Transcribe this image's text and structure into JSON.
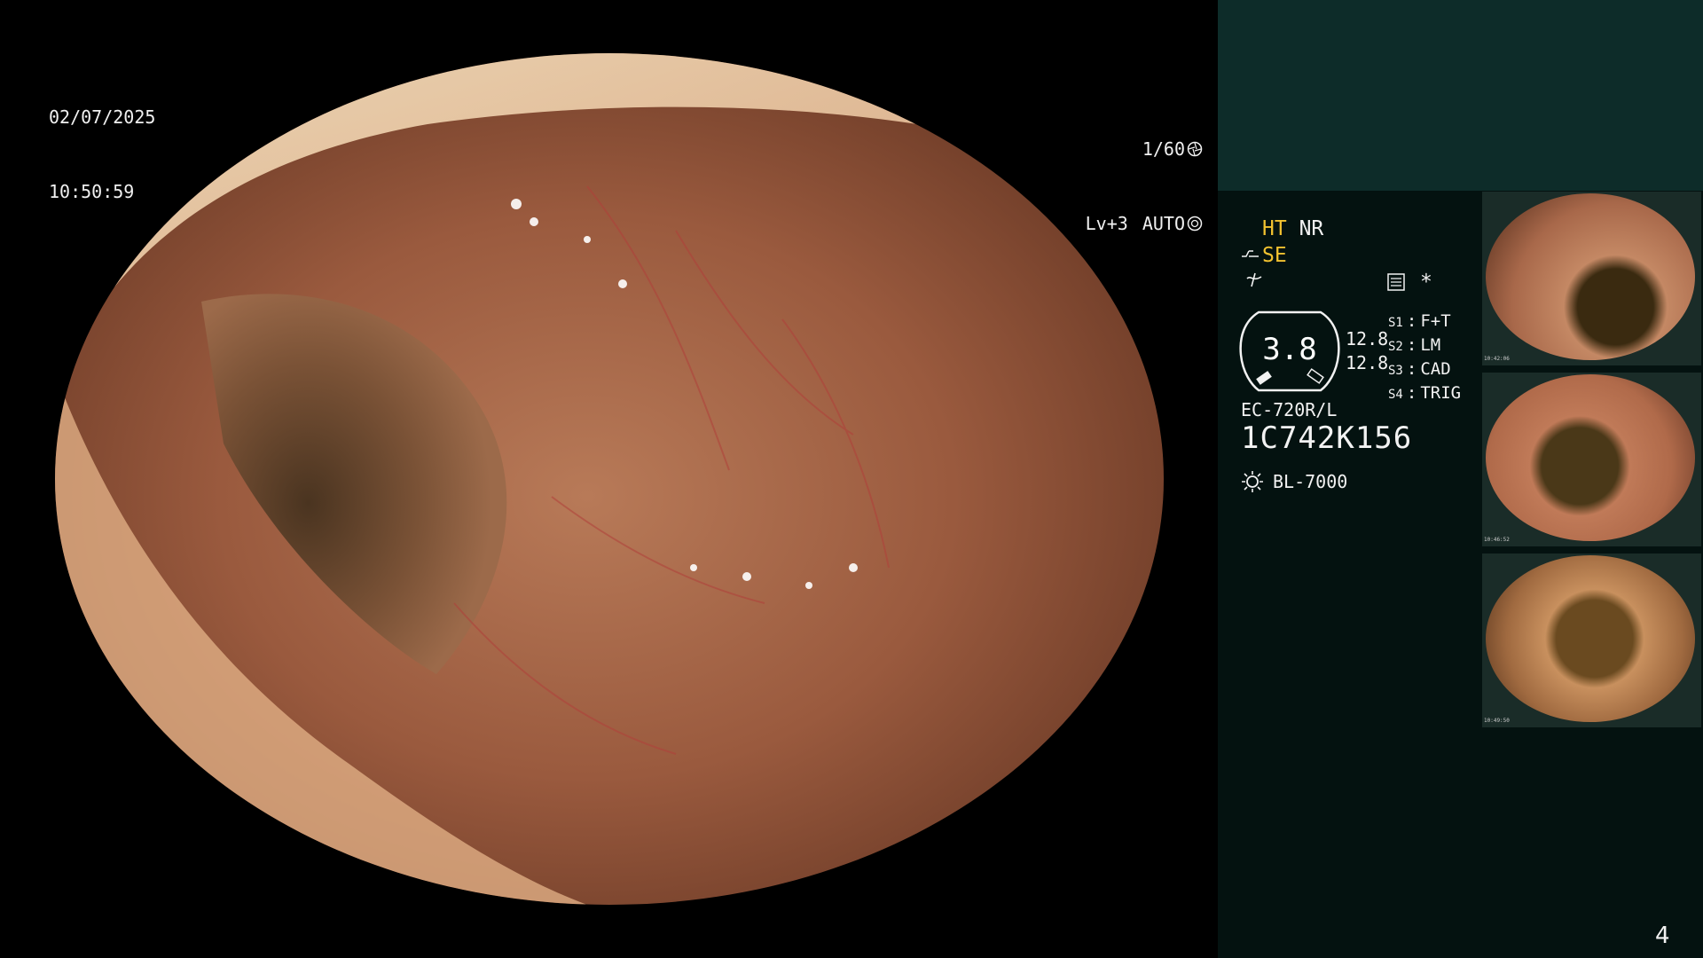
{
  "overlay": {
    "date": "02/07/2025",
    "time": "10:50:59",
    "shutter_speed": "1/60",
    "brightness_level": "Lv+3",
    "exposure_mode": "AUTO"
  },
  "info": {
    "ht": "HT",
    "nr": "NR",
    "se": "SE",
    "gauge_value": "3.8",
    "gauge_side_top": "12.8",
    "gauge_side_bottom": "12.8",
    "switches": [
      {
        "key": "S1",
        "value": "F+T"
      },
      {
        "key": "S2",
        "value": "LM"
      },
      {
        "key": "S3",
        "value": "CAD"
      },
      {
        "key": "S4",
        "value": "TRIG"
      }
    ],
    "scope_model": "EC-720R/L",
    "scope_serial": "1C742K156",
    "light_source": "BL-7000",
    "asterisk": "*"
  },
  "thumbnails": [
    {
      "caption": "10:42:06"
    },
    {
      "caption": "10:46:52"
    },
    {
      "caption": "10:49:50"
    }
  ],
  "page_number": "4",
  "colors": {
    "accent_yellow": "#f2c230",
    "panel_bg": "#041210",
    "panel_top_bg": "#0d2c29"
  }
}
